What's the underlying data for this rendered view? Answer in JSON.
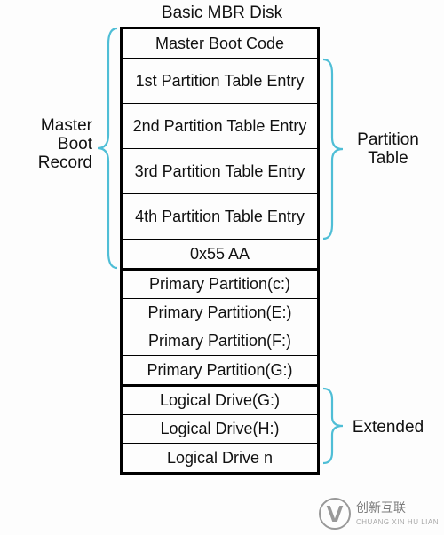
{
  "title": "Basic MBR Disk",
  "mbr": {
    "label_left": "Master\nBoot\nRecord",
    "label_right": "Partition\nTable",
    "cells": [
      "Master Boot Code",
      "1st Partition Table Entry",
      "2nd Partition Table Entry",
      "3rd Partition Table Entry",
      "4th Partition Table Entry",
      "0x55 AA"
    ]
  },
  "primary": [
    "Primary Partition(c:)",
    "Primary Partition(E:)",
    "Primary Partition(F:)",
    "Primary Partition(G:)"
  ],
  "logical": {
    "label_right": "Extended",
    "cells": [
      "Logical Drive(G:)",
      "Logical Drive(H:)",
      "Logical Drive n"
    ]
  },
  "watermark": {
    "brand": "创新互联",
    "tag": "CHUANG XIN HU LIAN"
  }
}
